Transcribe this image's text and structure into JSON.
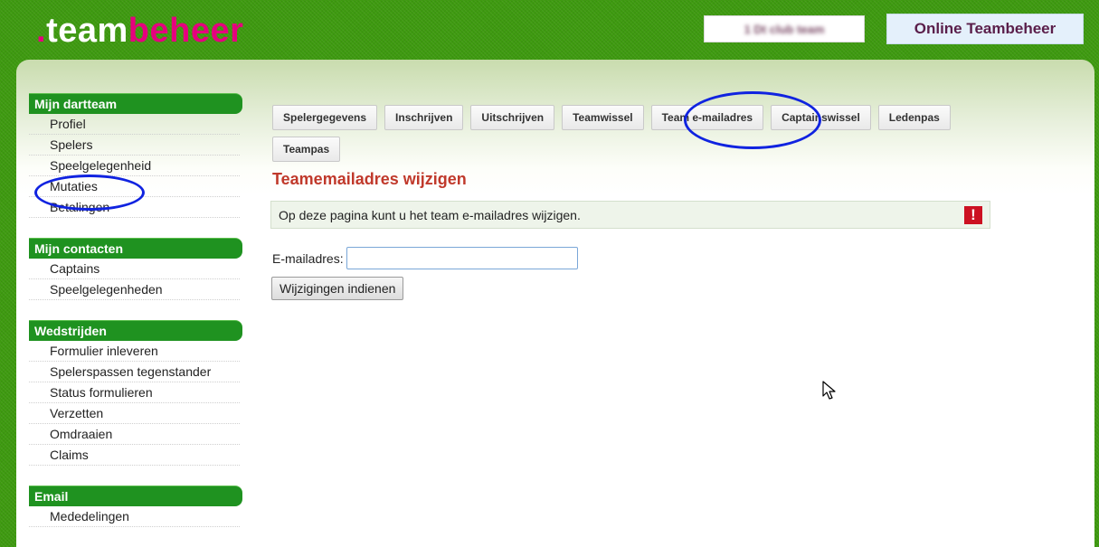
{
  "header": {
    "logo_dot": ".",
    "logo_team": "team",
    "logo_beheer": "beheer",
    "club_name_blurred": "1 Dt club team",
    "online_title": "Online Teambeheer"
  },
  "sidebar": {
    "groups": [
      {
        "title": "Mijn dartteam",
        "items": [
          "Profiel",
          "Spelers",
          "Speelgelegenheid",
          "Mutaties",
          "Betalingen"
        ]
      },
      {
        "title": "Mijn contacten",
        "items": [
          "Captains",
          "Speelgelegenheden"
        ]
      },
      {
        "title": "Wedstrijden",
        "items": [
          "Formulier inleveren",
          "Spelerspassen tegenstander",
          "Status formulieren",
          "Verzetten",
          "Omdraaien",
          "Claims"
        ]
      },
      {
        "title": "Email",
        "items": [
          "Mededelingen"
        ]
      }
    ]
  },
  "tabs": [
    "Spelergegevens",
    "Inschrijven",
    "Uitschrijven",
    "Teamwissel",
    "Team e-mailadres",
    "Captainswissel",
    "Ledenpas",
    "Teampas"
  ],
  "main": {
    "title": "Teamemailadres wijzigen",
    "info_text": "Op deze pagina kunt u het team e-mailadres wijzigen.",
    "info_icon": "!",
    "email_label": "E-mailadres:",
    "email_value": "",
    "submit_label": "Wijzigingen indienen"
  },
  "colors": {
    "background_green": "#3e9a10",
    "side_header_green": "#1f9220",
    "title_red": "#c0392b",
    "logo_magenta": "#e5007e",
    "annotation_blue": "#1023e0"
  }
}
